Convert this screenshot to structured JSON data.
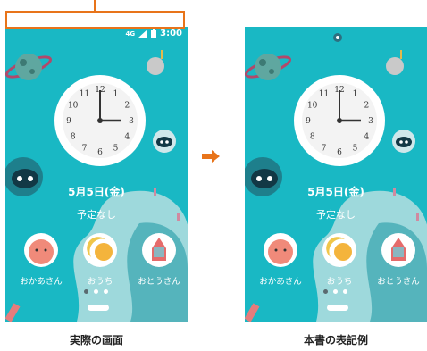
{
  "statusbar": {
    "network": "4G",
    "time": "3:00"
  },
  "home": {
    "date": "5月5日(金)",
    "schedule": "予定なし",
    "clock_numbers": [
      "12",
      "1",
      "2",
      "3",
      "4",
      "5",
      "6",
      "7",
      "8",
      "9",
      "10",
      "11"
    ],
    "apps": [
      {
        "label": "おかあさん",
        "icon": "mother-app-icon"
      },
      {
        "label": "おうち",
        "icon": "home-app-icon"
      },
      {
        "label": "おとうさん",
        "icon": "father-app-icon"
      }
    ]
  },
  "captions": {
    "actual": "実際の画面",
    "notation": "本書の表記例"
  },
  "colors": {
    "highlight": "#e8741a",
    "wallpaper": "#19b8c4",
    "arrow": "#e8741a"
  }
}
